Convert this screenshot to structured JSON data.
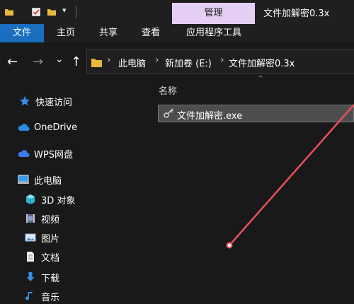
{
  "titlebar": {
    "context_tab": "管理",
    "window_title": "文件加解密0.3x"
  },
  "ribbon": {
    "tabs": [
      {
        "label": "文件"
      },
      {
        "label": "主页"
      },
      {
        "label": "共享"
      },
      {
        "label": "查看"
      },
      {
        "label": "应用程序工具"
      }
    ]
  },
  "navigation": {
    "back_icon": "←",
    "forward_icon": "→",
    "recent_icon": "⌄",
    "up_icon": "↑"
  },
  "address": {
    "crumbs": [
      "此电脑",
      "新加卷 (E:)",
      "文件加解密0.3x"
    ]
  },
  "nav_pane": {
    "items": [
      {
        "label": "快速访问",
        "icon": "star-icon"
      },
      {
        "label": "OneDrive",
        "icon": "cloud-icon"
      },
      {
        "label": "WPS网盘",
        "icon": "wps-cloud-icon"
      },
      {
        "label": "此电脑",
        "icon": "computer-icon"
      },
      {
        "label": "3D 对象",
        "icon": "cube-icon"
      },
      {
        "label": "视频",
        "icon": "video-icon"
      },
      {
        "label": "图片",
        "icon": "picture-icon"
      },
      {
        "label": "文档",
        "icon": "document-icon"
      },
      {
        "label": "下载",
        "icon": "download-icon"
      },
      {
        "label": "音乐",
        "icon": "music-icon"
      }
    ]
  },
  "content": {
    "column_header": "名称",
    "files": [
      {
        "name": "文件加解密.exe",
        "icon": "key-icon"
      }
    ]
  },
  "colors": {
    "file_tab": "#1a6fbf",
    "context_tab": "#e6cff5",
    "selection": "#4d4d4d",
    "pointer": "#e8505b"
  }
}
